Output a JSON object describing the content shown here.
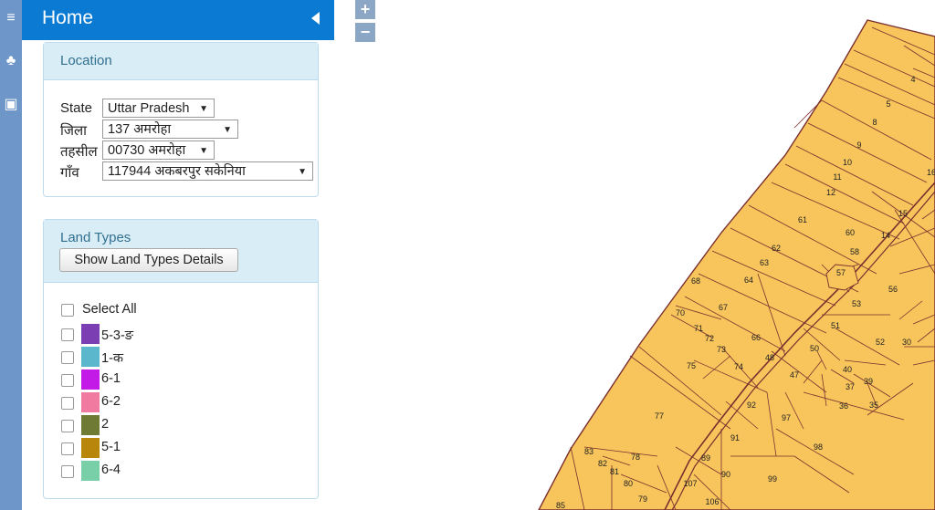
{
  "header": {
    "title": "Home"
  },
  "location": {
    "title": "Location",
    "state_label": "State",
    "state_value": "Uttar Pradesh",
    "district_label": "जिला",
    "district_value": "137 अमरोहा",
    "tehsil_label": "तहसील",
    "tehsil_value": "00730 अमरोहा",
    "village_label": "गाँव",
    "village_value": "117944 अकबरपुर सकेनिया"
  },
  "land_types": {
    "title": "Land Types",
    "details_button": "Show Land Types Details",
    "select_all": "Select All",
    "items": [
      {
        "label": "5-3-ङ",
        "color": "#7b3fb3"
      },
      {
        "label": "1-क",
        "color": "#5bb8cc"
      },
      {
        "label": "6-1",
        "color": "#c31ae8"
      },
      {
        "label": "6-2",
        "color": "#f07aa0"
      },
      {
        "label": "2",
        "color": "#6f7a35"
      },
      {
        "label": "5-1",
        "color": "#b8860b"
      },
      {
        "label": "6-4",
        "color": "#78cfa8"
      }
    ]
  },
  "zoom": {
    "in": "+",
    "out": "−"
  },
  "map": {
    "fill": "#f7c55c",
    "line": "#7a2e2e",
    "parcels": [
      "4",
      "5",
      "8",
      "9",
      "10",
      "11",
      "12",
      "15",
      "14",
      "16",
      "61",
      "60",
      "58",
      "62",
      "63",
      "64",
      "57",
      "56",
      "53",
      "68",
      "67",
      "70",
      "71",
      "72",
      "73",
      "66",
      "51",
      "50",
      "52",
      "30",
      "48",
      "74",
      "47",
      "40",
      "39",
      "75",
      "37",
      "36",
      "35",
      "92",
      "97",
      "77",
      "91",
      "98",
      "83",
      "82",
      "81",
      "78",
      "89",
      "90",
      "99",
      "80",
      "79",
      "107",
      "106",
      "85"
    ]
  }
}
